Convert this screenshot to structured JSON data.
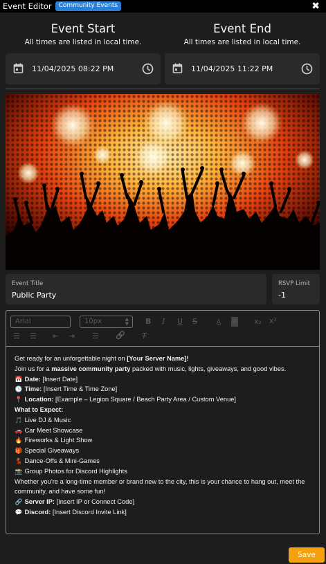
{
  "window": {
    "title": "Event Editor",
    "badge": "Community Events",
    "close": "✖"
  },
  "start": {
    "heading": "Event Start",
    "subtitle": "All times are listed in local time.",
    "value": "11/04/2025 08:22 PM"
  },
  "end": {
    "heading": "Event End",
    "subtitle": "All times are listed in local time.",
    "value": "11/04/2025 11:22 PM"
  },
  "event_title": {
    "label": "Event Title",
    "value": "Public Party"
  },
  "rsvp": {
    "label": "RSVP Limit",
    "value": "-1"
  },
  "toolbar": {
    "font": "Arial",
    "size": "10px",
    "bold": "B",
    "italic": "I",
    "underline": "U",
    "strike": "S",
    "text_color": "A",
    "highlight": "A",
    "subscript": "x₂",
    "superscript": "x²",
    "ordered_list": "☰",
    "bullet_list": "☰",
    "outdent": "⇤",
    "indent": "⇥",
    "align": "☰",
    "link": "🔗",
    "clear_format": "T"
  },
  "content": {
    "l1a": "Get ready for an unforgettable night on ",
    "l1b": "[Your Server Name]!",
    "l2a": " Join us for a ",
    "l2b": "massive community party",
    "l2c": " packed with music, lights, giveaways, and good vibes.",
    "date_e": "📅",
    "date_k": "Date:",
    "date_v": " [Insert Date]",
    "time_e": "🕒",
    "time_k": "Time:",
    "time_v": " [Insert Time & Time Zone]",
    "loc_e": "📍",
    "loc_k": "Location:",
    "loc_v": " [Example – Legion Square / Beach Party Area / Custom Venue]",
    "expect": "What to Expect:",
    "i1_e": "🎵",
    "i1": "Live DJ & Music",
    "i2_e": "🚗",
    "i2": "Car Meet Showcase",
    "i3_e": "🔥",
    "i3": "Fireworks & Light Show",
    "i4_e": "🎁",
    "i4": "Special Giveaways",
    "i5_e": "💃",
    "i5": "Dance-Offs & Mini-Games",
    "i6_e": "📸",
    "i6": "Group Photos for Discord Highlights",
    "outro": "Whether you’re a long-time member or brand new to the city, this is your chance to hang out, meet the community, and have some fun!",
    "ip_e": "🔗",
    "ip_k": "Server IP:",
    "ip_v": " [Insert IP or Connect Code]",
    "dc_e": "💬",
    "dc_k": "Discord:",
    "dc_v": " [Insert Discord Invite Link]"
  },
  "save_label": "Save",
  "colors": {
    "accent": "#f5a00e",
    "badge": "#2b7fd4",
    "panel": "#2a2a2a",
    "background": "#1d1d1d"
  }
}
